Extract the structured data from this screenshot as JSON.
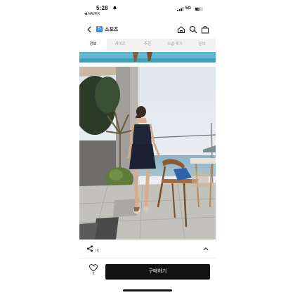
{
  "status_bar": {
    "time": "5:28",
    "carrier": "◀ NAVER",
    "network": "5G",
    "battery": "43"
  },
  "nav": {
    "brand_logo_text": "S",
    "brand_name": "스포츠"
  },
  "tabs": [
    {
      "label": "정보",
      "active": true
    },
    {
      "label": "사이즈",
      "active": false
    },
    {
      "label": "추천",
      "active": false
    },
    {
      "label": "스냅·후기",
      "active": false
    },
    {
      "label": "문의",
      "active": false
    }
  ],
  "share": {
    "label": "ric"
  },
  "like": {
    "count": "7"
  },
  "buy_button": {
    "label": "구매하기"
  },
  "colors": {
    "brand": "#2d8cf0",
    "buy_button": "#111111",
    "active_tab": "#ffffff",
    "tab_bar": "#f2f2f2"
  },
  "icons": [
    "notification-icon",
    "back-chevron-icon",
    "home-icon",
    "search-icon",
    "bag-icon",
    "share-icon",
    "chevron-up-icon",
    "heart-icon"
  ]
}
